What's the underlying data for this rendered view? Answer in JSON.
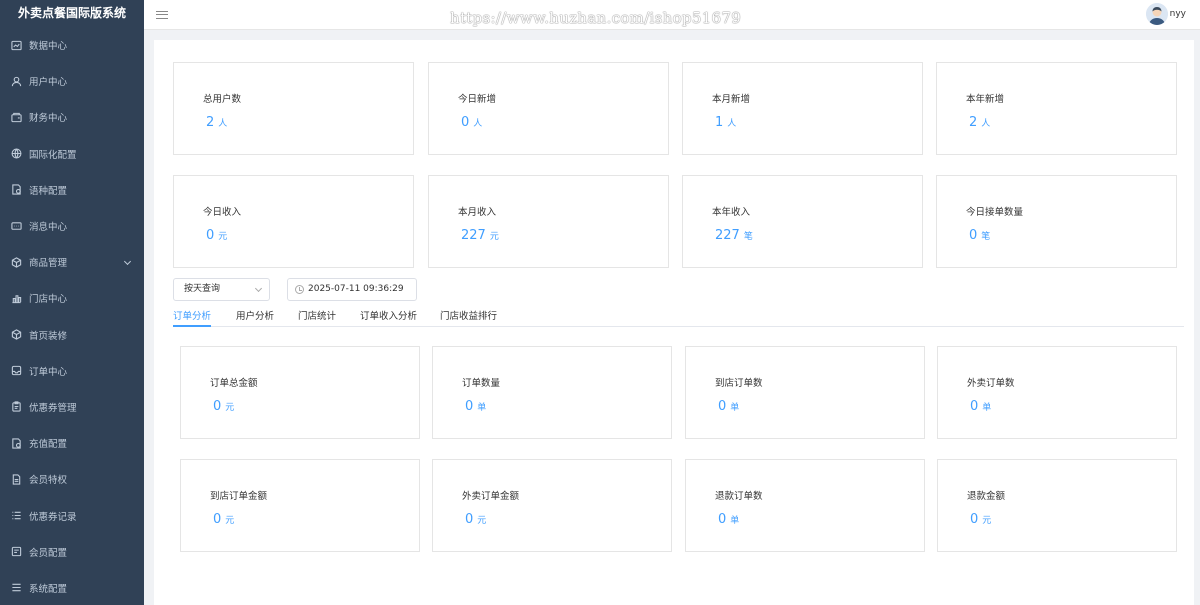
{
  "app": {
    "title": "外卖点餐国际版系统"
  },
  "header": {
    "watermark": "https://www.huzhan.com/ishop51679",
    "username": "nyy"
  },
  "sidebar": {
    "items": [
      {
        "label": "数据中心",
        "icon": "dashboard-icon"
      },
      {
        "label": "用户中心",
        "icon": "user-icon"
      },
      {
        "label": "财务中心",
        "icon": "wallet-icon"
      },
      {
        "label": "国际化配置",
        "icon": "globe-icon"
      },
      {
        "label": "语种配置",
        "icon": "language-icon"
      },
      {
        "label": "消息中心",
        "icon": "message-icon"
      },
      {
        "label": "商品管理",
        "icon": "box-icon",
        "expandable": true
      },
      {
        "label": "门店中心",
        "icon": "bar-chart-icon"
      },
      {
        "label": "首页装修",
        "icon": "cube-icon"
      },
      {
        "label": "订单中心",
        "icon": "inbox-icon"
      },
      {
        "label": "优惠券管理",
        "icon": "clipboard-icon"
      },
      {
        "label": "充值配置",
        "icon": "document-icon"
      },
      {
        "label": "会员特权",
        "icon": "file-icon"
      },
      {
        "label": "优惠券记录",
        "icon": "list-icon"
      },
      {
        "label": "会员配置",
        "icon": "form-icon"
      },
      {
        "label": "系统配置",
        "icon": "menu-icon"
      }
    ]
  },
  "stats": {
    "row1": [
      {
        "label": "总用户数",
        "value": "2",
        "unit": "人"
      },
      {
        "label": "今日新增",
        "value": "0",
        "unit": "人"
      },
      {
        "label": "本月新增",
        "value": "1",
        "unit": "人"
      },
      {
        "label": "本年新增",
        "value": "2",
        "unit": "人"
      }
    ],
    "row2": [
      {
        "label": "今日收入",
        "value": "0",
        "unit": "元"
      },
      {
        "label": "本月收入",
        "value": "227",
        "unit": "元"
      },
      {
        "label": "本年收入",
        "value": "227",
        "unit": "笔"
      },
      {
        "label": "今日接单数量",
        "value": "0",
        "unit": "笔"
      }
    ]
  },
  "filters": {
    "period_select": "按天查询",
    "date_value": "2025-07-11 09:36:29"
  },
  "tabs": [
    {
      "label": "订单分析",
      "active": true
    },
    {
      "label": "用户分析",
      "active": false
    },
    {
      "label": "门店统计",
      "active": false
    },
    {
      "label": "订单收入分析",
      "active": false
    },
    {
      "label": "门店收益排行",
      "active": false
    }
  ],
  "orders": {
    "row1": [
      {
        "label": "订单总金额",
        "value": "0",
        "unit": "元"
      },
      {
        "label": "订单数量",
        "value": "0",
        "unit": "单"
      },
      {
        "label": "到店订单数",
        "value": "0",
        "unit": "单"
      },
      {
        "label": "外卖订单数",
        "value": "0",
        "unit": "单"
      }
    ],
    "row2": [
      {
        "label": "到店订单金额",
        "value": "0",
        "unit": "元"
      },
      {
        "label": "外卖订单金额",
        "value": "0",
        "unit": "元"
      },
      {
        "label": "退款订单数",
        "value": "0",
        "unit": "单"
      },
      {
        "label": "退款金额",
        "value": "0",
        "unit": "元"
      }
    ]
  },
  "colors": {
    "sidebar_bg": "#304156",
    "accent": "#409eff"
  }
}
